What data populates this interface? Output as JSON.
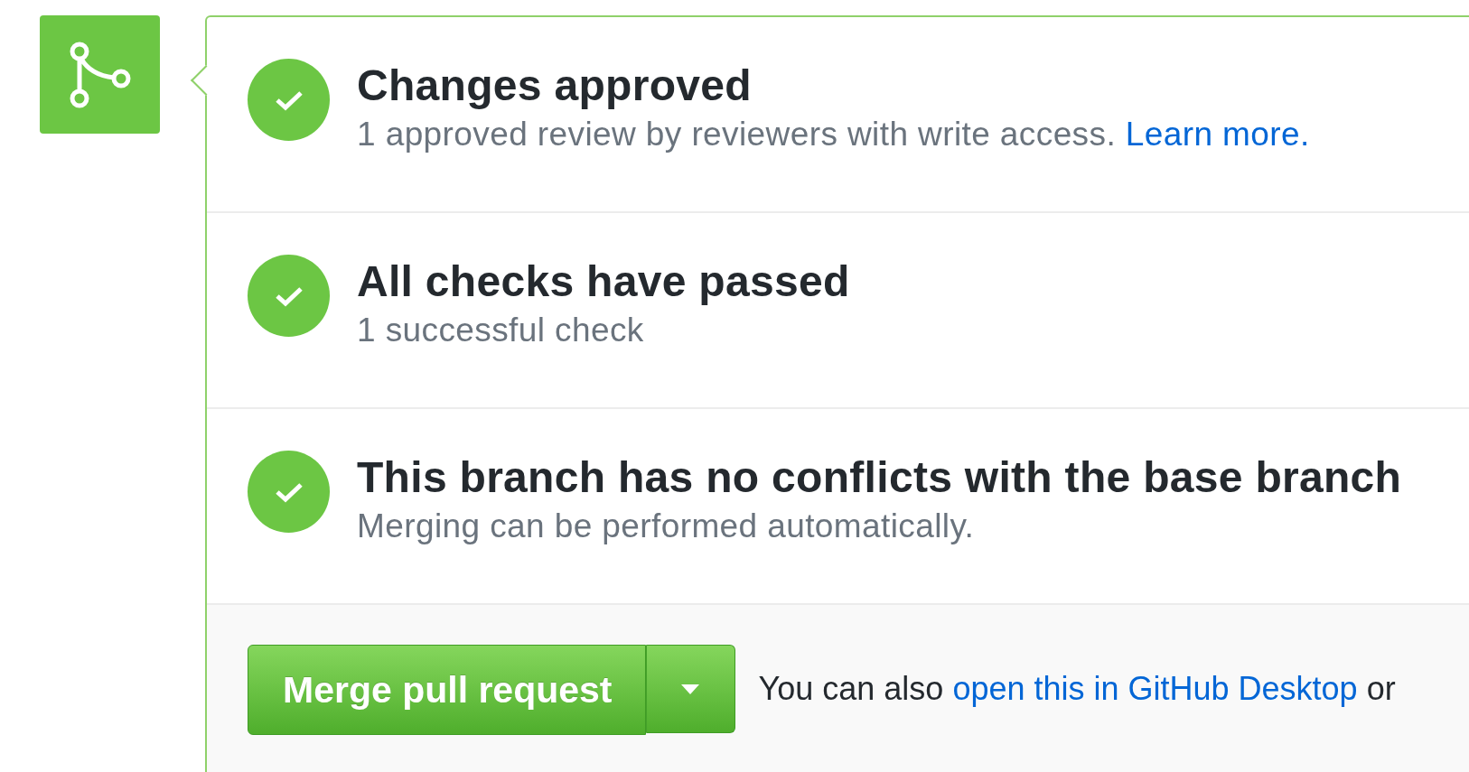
{
  "merge_box": {
    "mergeable": true,
    "checks": [
      {
        "passed": true,
        "title": "Changes approved",
        "description": "1 approved review by reviewers with write access.",
        "link": "Learn more."
      },
      {
        "passed": true,
        "title": "All checks have passed",
        "description": "1 successful check"
      },
      {
        "passed": true,
        "title": "This branch has no conflicts with the base branch",
        "description": "Merging can be performed automatically."
      }
    ],
    "merge_button": {
      "label": "Merge pull request"
    },
    "footer": {
      "text_before": "You can also",
      "link": "open this in GitHub Desktop",
      "text_after": "or"
    }
  }
}
